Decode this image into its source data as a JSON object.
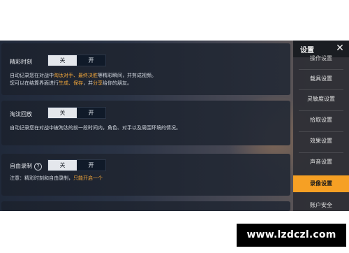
{
  "sections": [
    {
      "label": "精彩时刻",
      "toggle": {
        "off": "关",
        "on": "开"
      },
      "desc_line1": [
        "自动记录您在对战中",
        "淘汰对手、最终决胜",
        "等精彩瞬间，并剪成视频。"
      ],
      "desc_line2": [
        "您可以在结算界面进行",
        "生成、保存",
        "，并",
        "分享",
        "给你的朋友。"
      ]
    },
    {
      "label": "淘汰回放",
      "toggle": {
        "off": "关",
        "on": "开"
      },
      "desc": "自动记录您在对战中被淘汰的前一段时间内，角色、对手以及周围环境的情况。"
    },
    {
      "label": "自由录制",
      "help_icon": "?",
      "toggle": {
        "off": "关",
        "on": "开"
      },
      "note": [
        "注意：精彩时刻和自由录制，",
        "只能开启一个"
      ]
    }
  ],
  "sidebar": {
    "title": "设置",
    "close": "✕",
    "items": [
      {
        "label": "操作设置"
      },
      {
        "label": "载具设置"
      },
      {
        "label": "灵敏度设置"
      },
      {
        "label": "拾取设置"
      },
      {
        "label": "效果设置"
      },
      {
        "label": "声音设置"
      },
      {
        "label": "录像设置",
        "active": true
      },
      {
        "label": "账户安全"
      }
    ]
  },
  "watermark": "www.lzdczl.com",
  "colors": {
    "accent": "#f6a024",
    "highlight": "#f3a73a",
    "panel": "#1e2430"
  }
}
